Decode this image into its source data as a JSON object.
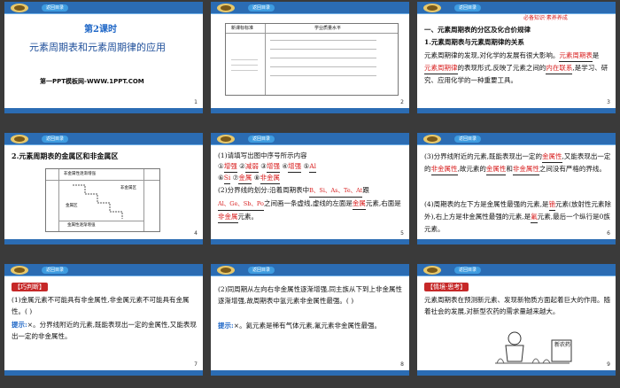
{
  "common": {
    "back": "返回目录"
  },
  "slides": [
    {
      "num": "1",
      "lesson": "第2课时",
      "title": "元素周期表和元素周期律的应用",
      "footer": "第一PPT模板网-WWW.1PPT.COM"
    },
    {
      "num": "2",
      "col1": "新课标标准",
      "col2": "学业质量水平"
    },
    {
      "num": "3",
      "banner": "必备知识·素养养成",
      "h1": "一、元素周期表的分区及化合价规律",
      "h2": "1.元素周期表与元素周期律的关系",
      "p1": "元素周期律的发现,对化学的发展有很大影响。",
      "a1": "元素周期表",
      "p2": "是",
      "a2": "元素周期律",
      "p3": "的表现形式,反映了元素之间的",
      "a3": "内在联系",
      "p4": ",是学习、研究、应用化学的一种重要工具。"
    },
    {
      "num": "4",
      "h": "2.元素周期表的金属区和非金属区",
      "lab1": "非金属性逐渐增强",
      "lab2": "金属性逐渐增强",
      "lab3": "金属区",
      "lab4": "非金属区"
    },
    {
      "num": "5",
      "q1": "(1)请填写出图中序号所示内容",
      "n1": "①",
      "a1": "增强",
      "n2": "②",
      "a2": "减弱",
      "n3": "③",
      "a3": "增强",
      "n4": "④",
      "a4": "增强",
      "n5": "⑤",
      "a5": "Al",
      "n6": "⑥",
      "a6": "Si",
      "n7": "⑦",
      "a7": "金属",
      "n8": "⑧",
      "a8": "非金属",
      "q2": "(2)分界线的划分:沿着周期表中",
      "a9": "B、Si、As、Te、At",
      "q3": "跟",
      "a10": "Al、Ge、Sb、Po",
      "q4": "之间画一条虚线,虚线的左面是",
      "a11": "金属",
      "q5": "元素,右面是",
      "a12": "非金属",
      "q6": "元素。"
    },
    {
      "num": "6",
      "p1": "(3)分界线附近的元素,既能表现出一定的",
      "a1": "金属性",
      "p2": ",又能表现出一定的",
      "a2": "非金属性",
      "p3": ",故元素的",
      "a3": "金属性",
      "p4": "和",
      "a4": "非金属性",
      "p5": "之间没有严格的界线。",
      "p6": "(4)周期表的左下方是金属性最强的元素,是",
      "a5": "铯",
      "p7": "元素(放射性元素除外),右上方是非金属性最强的元素,是",
      "a6": "氟",
      "p8": "元素,最后一个纵行是0族元素。"
    },
    {
      "num": "7",
      "tag": "【巧判断】",
      "p1": "(1)金属元素不可能具有非金属性,非金属元素不可能具有金属性。(    )",
      "hint": "提示:",
      "p2": "×。分界线附近的元素,既能表现出一定的金属性,又能表现出一定的非金属性。"
    },
    {
      "num": "8",
      "p1": "(2)同周期从左向右非金属性逐渐增强,同主族从下到上非金属性逐渐增强,故周期表中氢元素非金属性最强。(    )",
      "hint": "提示:",
      "p2": "×。氦元素是稀有气体元素,氟元素非金属性最强。"
    },
    {
      "num": "9",
      "tag": "【情境·思考】",
      "p1": "元素周期表在预测新元素、发现新物质方面起着巨大的作用。随着社会的发展,对新型农药的需求量越来越大。",
      "stamp": "新农药"
    }
  ]
}
